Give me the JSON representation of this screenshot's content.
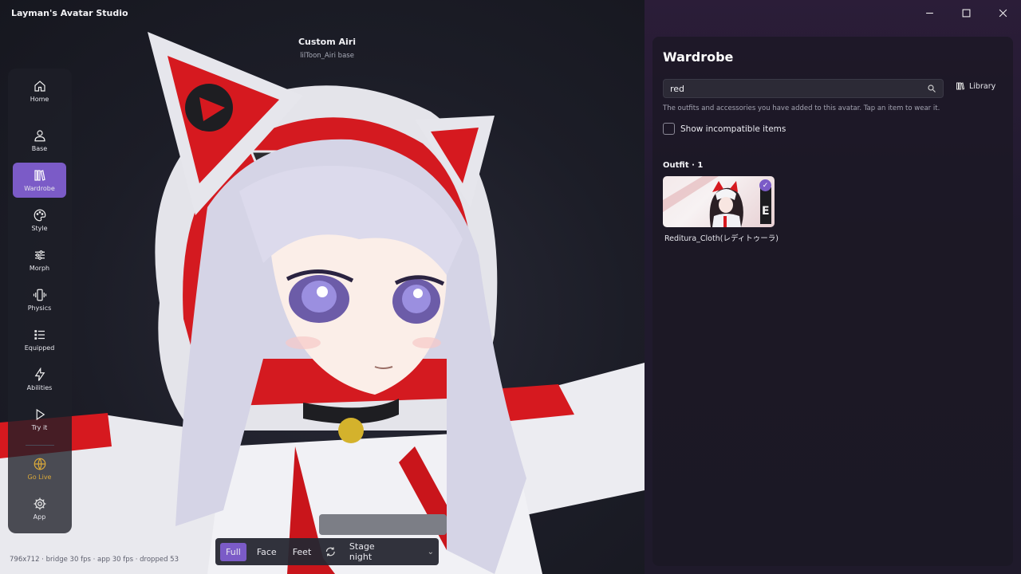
{
  "app": {
    "title": "Layman's Avatar Studio"
  },
  "avatar": {
    "name": "Custom Airi",
    "base": "lilToon_Airi base"
  },
  "stats": "796x712 · bridge 30 fps · app 30 fps · dropped 53",
  "sidebar": {
    "items": [
      {
        "label": "Home",
        "icon": "home-icon",
        "active": false
      },
      {
        "label": "Base",
        "icon": "person-icon",
        "active": false
      },
      {
        "label": "Wardrobe",
        "icon": "wardrobe-icon",
        "active": true
      },
      {
        "label": "Style",
        "icon": "palette-icon",
        "active": false
      },
      {
        "label": "Morph",
        "icon": "sliders-icon",
        "active": false
      },
      {
        "label": "Physics",
        "icon": "vibration-icon",
        "active": false
      },
      {
        "label": "Equipped",
        "icon": "list-icon",
        "active": false
      },
      {
        "label": "Abilities",
        "icon": "lightning-icon",
        "active": false
      },
      {
        "label": "Try it",
        "icon": "play-icon",
        "active": false
      },
      {
        "label": "Go Live",
        "icon": "globe-icon",
        "active": false
      },
      {
        "label": "App",
        "icon": "gear-icon",
        "active": false
      }
    ]
  },
  "viewbar": {
    "buttons": [
      "Full",
      "Face",
      "Feet"
    ],
    "active": "Full",
    "stage": "Stage night"
  },
  "wardrobe": {
    "title": "Wardrobe",
    "search_value": "red",
    "library_label": "Library",
    "hint": "The outfits and accessories you have added to this avatar. Tap an item to wear it.",
    "show_incompatible_label": "Show incompatible items",
    "show_incompatible_checked": false,
    "section_title": "Outfit · 1",
    "items": [
      {
        "name": "Reditura_Cloth(レディトゥーラ)",
        "worn": true
      }
    ]
  },
  "colors": {
    "accent": "#7b5bc7",
    "golive": "#d9a83a"
  }
}
